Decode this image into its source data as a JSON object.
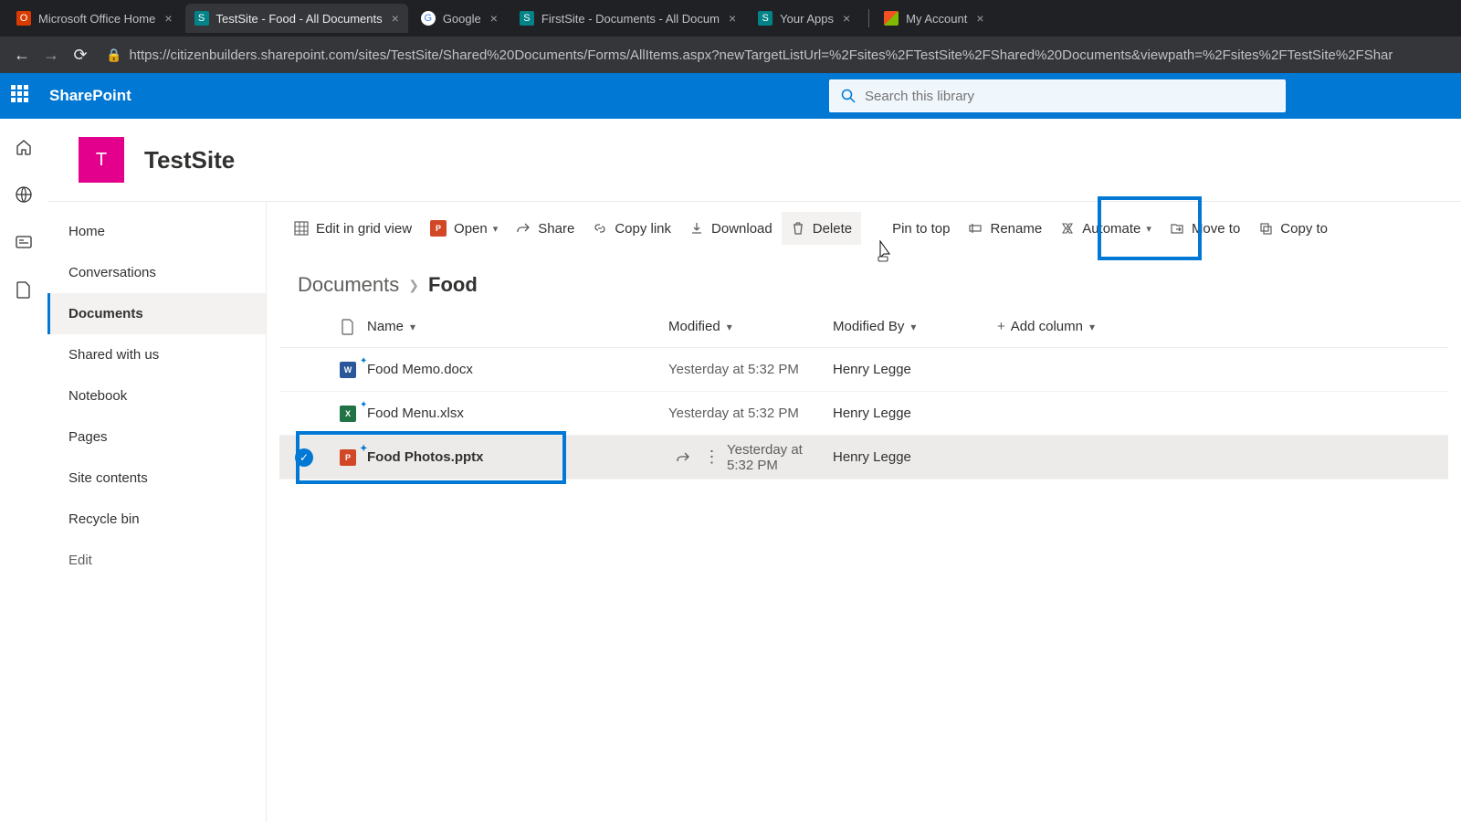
{
  "browser": {
    "tabs": [
      {
        "label": "Microsoft Office Home",
        "iconColor": "#d83b01"
      },
      {
        "label": "TestSite - Food - All Documents",
        "iconColor": "#038387",
        "active": true
      },
      {
        "label": "Google",
        "iconColor": "#4285f4"
      },
      {
        "label": "FirstSite - Documents - All Docum",
        "iconColor": "#038387"
      },
      {
        "label": "Your Apps",
        "iconColor": "#038387"
      },
      {
        "label": "My Account",
        "iconColor": "#0078d4"
      }
    ],
    "url": "https://citizenbuilders.sharepoint.com/sites/TestSite/Shared%20Documents/Forms/AllItems.aspx?newTargetListUrl=%2Fsites%2FTestSite%2FShared%20Documents&viewpath=%2Fsites%2FTestSite%2FShar"
  },
  "suite": {
    "name": "SharePoint",
    "searchPlaceholder": "Search this library"
  },
  "site": {
    "logoLetter": "T",
    "title": "TestSite"
  },
  "leftnav": {
    "items": [
      "Home",
      "Conversations",
      "Documents",
      "Shared with us",
      "Notebook",
      "Pages",
      "Site contents",
      "Recycle bin"
    ],
    "selectedIndex": 2,
    "edit": "Edit"
  },
  "commands": {
    "editGrid": "Edit in grid view",
    "open": "Open",
    "share": "Share",
    "copyLink": "Copy link",
    "download": "Download",
    "delete": "Delete",
    "pinToTop": "Pin to top",
    "rename": "Rename",
    "automate": "Automate",
    "moveTo": "Move to",
    "copyTo": "Copy to"
  },
  "breadcrumb": {
    "root": "Documents",
    "current": "Food"
  },
  "columns": {
    "name": "Name",
    "modified": "Modified",
    "modifiedBy": "Modified By",
    "add": "Add column"
  },
  "files": [
    {
      "type": "word",
      "name": "Food Memo.docx",
      "modified": "Yesterday at 5:32 PM",
      "modifiedBy": "Henry Legge",
      "selected": false
    },
    {
      "type": "excel",
      "name": "Food Menu.xlsx",
      "modified": "Yesterday at 5:32 PM",
      "modifiedBy": "Henry Legge",
      "selected": false
    },
    {
      "type": "ppt",
      "name": "Food Photos.pptx",
      "modified": "Yesterday at 5:32 PM",
      "modifiedBy": "Henry Legge",
      "selected": true
    }
  ]
}
